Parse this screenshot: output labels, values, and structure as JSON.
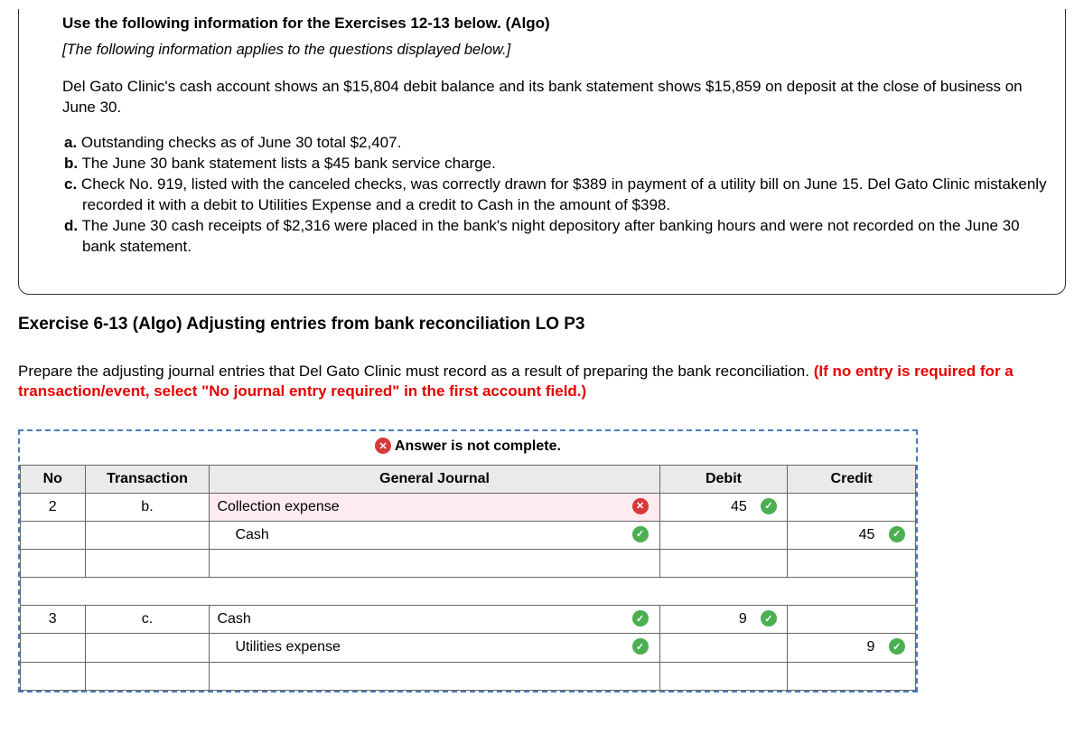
{
  "info": {
    "title": "Use the following information for the Exercises 12-13 below. (Algo)",
    "subtitle": "[The following information applies to the questions displayed below.]",
    "paragraph": "Del Gato Clinic's cash account shows an $15,804 debit balance and its bank statement shows $15,859 on deposit at the close of business on June 30.",
    "items": {
      "a_label": "a.",
      "a_text": " Outstanding checks as of June 30 total $2,407.",
      "b_label": "b.",
      "b_text": " The June 30 bank statement lists a $45 bank service charge.",
      "c_label": "c.",
      "c_text": " Check No. 919, listed with the canceled checks, was correctly drawn for $389 in payment of a utility bill on June 15. Del Gato Clinic mistakenly recorded it with a debit to Utilities Expense and a credit to Cash in the amount of $398.",
      "d_label": "d.",
      "d_text": " The June 30 cash receipts of $2,316 were placed in the bank's night depository after banking hours and were not recorded on the June 30 bank statement."
    }
  },
  "exercise": {
    "title": "Exercise 6-13 (Algo) Adjusting entries from bank reconciliation LO P3",
    "instruction_plain": "Prepare the adjusting journal entries that Del Gato Clinic must record as a result of preparing the bank reconciliation. ",
    "instruction_red": "(If no entry is required for a transaction/event, select \"No journal entry required\" in the first account field.)"
  },
  "answer": {
    "banner": "Answer is not complete.",
    "headers": {
      "no": "No",
      "transaction": "Transaction",
      "journal": "General Journal",
      "debit": "Debit",
      "credit": "Credit"
    },
    "rows": [
      {
        "no": "2",
        "trans": "b.",
        "acct": "Collection expense",
        "acct_status": "wrong",
        "debit": "45",
        "debit_status": "correct",
        "credit": "",
        "credit_status": ""
      },
      {
        "no": "",
        "trans": "",
        "acct": "Cash",
        "acct_indent": true,
        "acct_status": "correct",
        "debit": "",
        "debit_status": "",
        "credit": "45",
        "credit_status": "correct"
      },
      {
        "no": "",
        "trans": "",
        "acct": "",
        "debit": "",
        "credit": ""
      }
    ],
    "rows2": [
      {
        "no": "3",
        "trans": "c.",
        "acct": "Cash",
        "acct_status": "correct",
        "debit": "9",
        "debit_status": "correct",
        "credit": "",
        "credit_status": ""
      },
      {
        "no": "",
        "trans": "",
        "acct": "Utilities expense",
        "acct_indent": true,
        "acct_status": "correct",
        "debit": "",
        "debit_status": "",
        "credit": "9",
        "credit_status": "correct"
      },
      {
        "no": "",
        "trans": "",
        "acct": "",
        "debit": "",
        "credit": ""
      }
    ]
  }
}
